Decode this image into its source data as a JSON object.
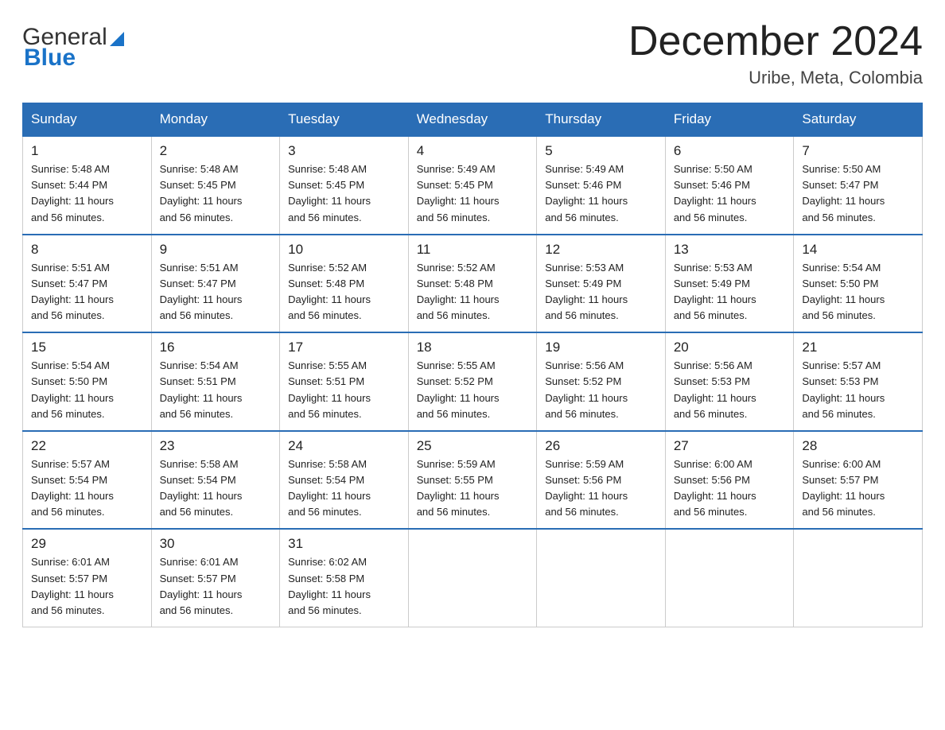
{
  "header": {
    "logo": {
      "general": "General",
      "blue": "Blue",
      "underline": "Blue"
    },
    "title": "December 2024",
    "subtitle": "Uribe, Meta, Colombia"
  },
  "columns": [
    "Sunday",
    "Monday",
    "Tuesday",
    "Wednesday",
    "Thursday",
    "Friday",
    "Saturday"
  ],
  "weeks": [
    [
      {
        "day": "1",
        "sunrise": "5:48 AM",
        "sunset": "5:44 PM",
        "daylight": "11 hours and 56 minutes."
      },
      {
        "day": "2",
        "sunrise": "5:48 AM",
        "sunset": "5:45 PM",
        "daylight": "11 hours and 56 minutes."
      },
      {
        "day": "3",
        "sunrise": "5:48 AM",
        "sunset": "5:45 PM",
        "daylight": "11 hours and 56 minutes."
      },
      {
        "day": "4",
        "sunrise": "5:49 AM",
        "sunset": "5:45 PM",
        "daylight": "11 hours and 56 minutes."
      },
      {
        "day": "5",
        "sunrise": "5:49 AM",
        "sunset": "5:46 PM",
        "daylight": "11 hours and 56 minutes."
      },
      {
        "day": "6",
        "sunrise": "5:50 AM",
        "sunset": "5:46 PM",
        "daylight": "11 hours and 56 minutes."
      },
      {
        "day": "7",
        "sunrise": "5:50 AM",
        "sunset": "5:47 PM",
        "daylight": "11 hours and 56 minutes."
      }
    ],
    [
      {
        "day": "8",
        "sunrise": "5:51 AM",
        "sunset": "5:47 PM",
        "daylight": "11 hours and 56 minutes."
      },
      {
        "day": "9",
        "sunrise": "5:51 AM",
        "sunset": "5:47 PM",
        "daylight": "11 hours and 56 minutes."
      },
      {
        "day": "10",
        "sunrise": "5:52 AM",
        "sunset": "5:48 PM",
        "daylight": "11 hours and 56 minutes."
      },
      {
        "day": "11",
        "sunrise": "5:52 AM",
        "sunset": "5:48 PM",
        "daylight": "11 hours and 56 minutes."
      },
      {
        "day": "12",
        "sunrise": "5:53 AM",
        "sunset": "5:49 PM",
        "daylight": "11 hours and 56 minutes."
      },
      {
        "day": "13",
        "sunrise": "5:53 AM",
        "sunset": "5:49 PM",
        "daylight": "11 hours and 56 minutes."
      },
      {
        "day": "14",
        "sunrise": "5:54 AM",
        "sunset": "5:50 PM",
        "daylight": "11 hours and 56 minutes."
      }
    ],
    [
      {
        "day": "15",
        "sunrise": "5:54 AM",
        "sunset": "5:50 PM",
        "daylight": "11 hours and 56 minutes."
      },
      {
        "day": "16",
        "sunrise": "5:54 AM",
        "sunset": "5:51 PM",
        "daylight": "11 hours and 56 minutes."
      },
      {
        "day": "17",
        "sunrise": "5:55 AM",
        "sunset": "5:51 PM",
        "daylight": "11 hours and 56 minutes."
      },
      {
        "day": "18",
        "sunrise": "5:55 AM",
        "sunset": "5:52 PM",
        "daylight": "11 hours and 56 minutes."
      },
      {
        "day": "19",
        "sunrise": "5:56 AM",
        "sunset": "5:52 PM",
        "daylight": "11 hours and 56 minutes."
      },
      {
        "day": "20",
        "sunrise": "5:56 AM",
        "sunset": "5:53 PM",
        "daylight": "11 hours and 56 minutes."
      },
      {
        "day": "21",
        "sunrise": "5:57 AM",
        "sunset": "5:53 PM",
        "daylight": "11 hours and 56 minutes."
      }
    ],
    [
      {
        "day": "22",
        "sunrise": "5:57 AM",
        "sunset": "5:54 PM",
        "daylight": "11 hours and 56 minutes."
      },
      {
        "day": "23",
        "sunrise": "5:58 AM",
        "sunset": "5:54 PM",
        "daylight": "11 hours and 56 minutes."
      },
      {
        "day": "24",
        "sunrise": "5:58 AM",
        "sunset": "5:54 PM",
        "daylight": "11 hours and 56 minutes."
      },
      {
        "day": "25",
        "sunrise": "5:59 AM",
        "sunset": "5:55 PM",
        "daylight": "11 hours and 56 minutes."
      },
      {
        "day": "26",
        "sunrise": "5:59 AM",
        "sunset": "5:56 PM",
        "daylight": "11 hours and 56 minutes."
      },
      {
        "day": "27",
        "sunrise": "6:00 AM",
        "sunset": "5:56 PM",
        "daylight": "11 hours and 56 minutes."
      },
      {
        "day": "28",
        "sunrise": "6:00 AM",
        "sunset": "5:57 PM",
        "daylight": "11 hours and 56 minutes."
      }
    ],
    [
      {
        "day": "29",
        "sunrise": "6:01 AM",
        "sunset": "5:57 PM",
        "daylight": "11 hours and 56 minutes."
      },
      {
        "day": "30",
        "sunrise": "6:01 AM",
        "sunset": "5:57 PM",
        "daylight": "11 hours and 56 minutes."
      },
      {
        "day": "31",
        "sunrise": "6:02 AM",
        "sunset": "5:58 PM",
        "daylight": "11 hours and 56 minutes."
      },
      null,
      null,
      null,
      null
    ]
  ]
}
